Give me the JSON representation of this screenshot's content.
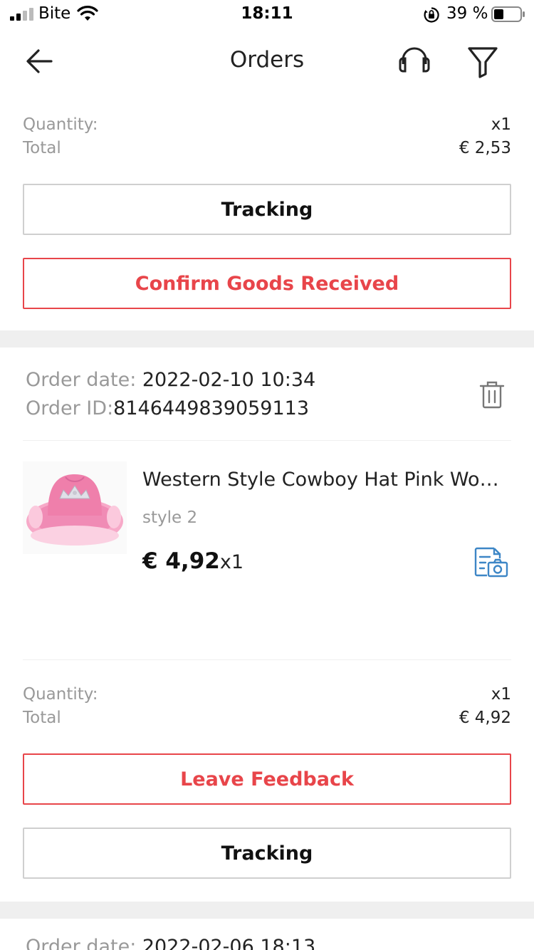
{
  "status_bar": {
    "carrier": "Bite",
    "time": "18:11",
    "battery": "39 %"
  },
  "nav": {
    "title": "Orders"
  },
  "order_prev": {
    "quantity_label": "Quantity:",
    "quantity_value": "x1",
    "total_label": "Total",
    "total_value": "€ 2,53",
    "tracking_label": "Tracking",
    "confirm_label": "Confirm Goods Received"
  },
  "order_current": {
    "date_label": "Order date: ",
    "date_value": "2022-02-10 10:34",
    "id_label": "Order ID:",
    "id_value": "8146449839059113",
    "product": {
      "title": "Western Style Cowboy Hat Pink Women's Cowgirl Hat",
      "variant": "style 2",
      "price": "€ 4,92",
      "qty": "x1"
    },
    "quantity_label": "Quantity:",
    "quantity_value": "x1",
    "total_label": "Total",
    "total_value": "€ 4,92",
    "feedback_label": "Leave Feedback",
    "tracking_label": "Tracking"
  },
  "order_next": {
    "date_label": "Order date: ",
    "date_value": "2022-02-06 18:13"
  },
  "colors": {
    "accent_red": "#e8454a",
    "link_blue": "#3d86c6",
    "separator": "#efefef"
  },
  "icons": [
    "signal-icon",
    "wifi-icon",
    "orientation-lock-icon",
    "battery-icon",
    "back-arrow-icon",
    "headset-icon",
    "filter-icon",
    "trash-icon",
    "snapshot-icon"
  ]
}
